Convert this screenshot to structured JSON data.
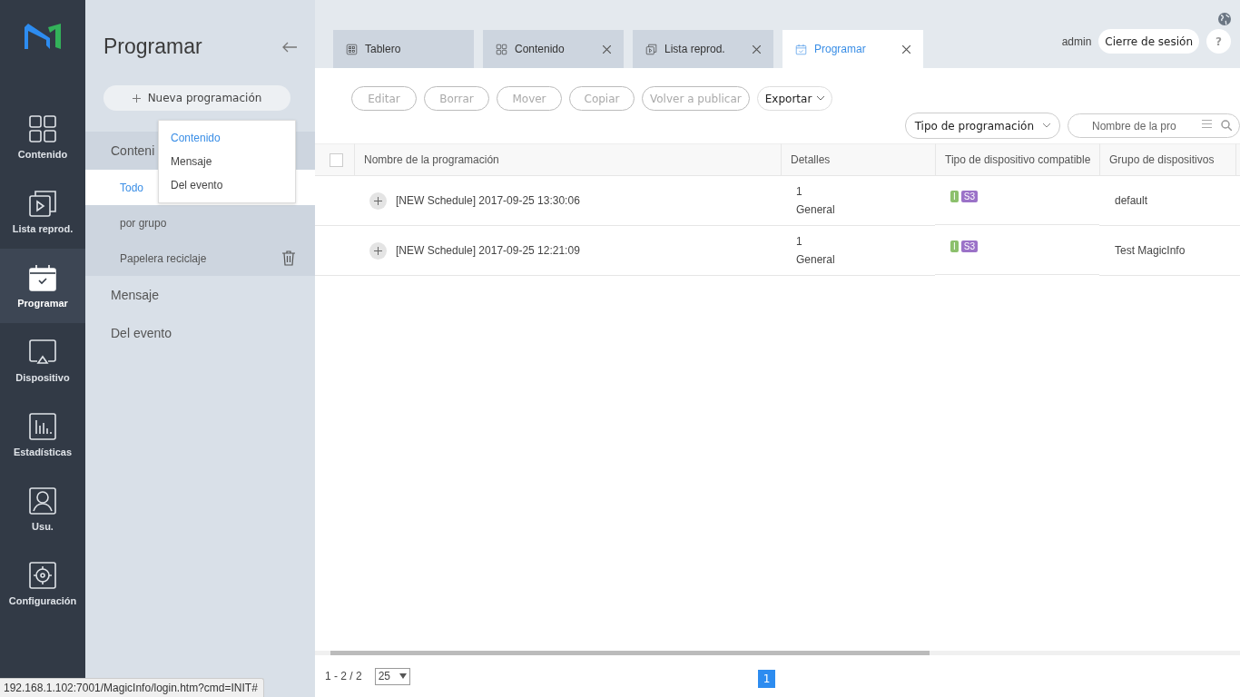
{
  "nav": {
    "items": [
      {
        "label": "Contenido",
        "selected": false
      },
      {
        "label": "Lista reprod.",
        "selected": false
      },
      {
        "label": "Programar",
        "selected": true
      },
      {
        "label": "Dispositivo",
        "selected": false
      },
      {
        "label": "Estadísticas",
        "selected": false
      },
      {
        "label": "Usu.",
        "selected": false
      },
      {
        "label": "Configuración",
        "selected": false
      }
    ]
  },
  "panel": {
    "title": "Programar",
    "new_button": "Nueva programación",
    "menu": [
      {
        "label": "Contenido",
        "selected": true
      },
      {
        "label": "Mensaje",
        "selected": false
      },
      {
        "label": "Del evento",
        "selected": false
      }
    ],
    "tree": [
      {
        "label": "Conteni",
        "expanded": true,
        "children": [
          {
            "label": "Todo",
            "selected": true,
            "kind": "plain"
          },
          {
            "label": "por grupo",
            "selected": false,
            "kind": "plain"
          },
          {
            "label": "Papelera reciclaje",
            "selected": false,
            "kind": "trash"
          }
        ]
      },
      {
        "label": "Mensaje",
        "expanded": false
      },
      {
        "label": "Del evento",
        "expanded": false
      }
    ]
  },
  "tabs": [
    {
      "label": "Tablero",
      "selected": false,
      "closable": false
    },
    {
      "label": "Contenido",
      "selected": false,
      "closable": true
    },
    {
      "label": "Lista reprod.",
      "selected": false,
      "closable": true
    },
    {
      "label": "Programar",
      "selected": true,
      "closable": true
    }
  ],
  "header": {
    "user": "admin",
    "logout": "Cierre de sesión",
    "help": "?"
  },
  "toolbar": [
    {
      "label": "Editar",
      "disabled": true
    },
    {
      "label": "Borrar",
      "disabled": true
    },
    {
      "label": "Mover",
      "disabled": true
    },
    {
      "label": "Copiar",
      "disabled": true
    },
    {
      "label": "Volver a publicar",
      "disabled": true
    }
  ],
  "export": "Exportar",
  "filter": "Tipo de programación",
  "search": {
    "placeholder": "Nombre de la pro"
  },
  "table": {
    "select_all": {
      "checked": false
    },
    "columns": [
      "Nombre de la programación",
      "Detalles",
      "Tipo de dispositivo compatible",
      "Grupo de dispositivos"
    ],
    "rows": [
      {
        "name": "[NEW Schedule] 2017-09-25 13:30:06",
        "details": [
          "1",
          "General"
        ],
        "types": [
          {
            "label": "I",
            "color": "#8cc06c"
          },
          {
            "label": "S3",
            "color": "#9b72c8"
          }
        ],
        "group": "default"
      },
      {
        "name": "[NEW Schedule] 2017-09-25 12:21:09",
        "details": [
          "1",
          "General"
        ],
        "types": [
          {
            "label": "I",
            "color": "#8cc06c"
          },
          {
            "label": "S3",
            "color": "#9b72c8"
          }
        ],
        "group": "Test MagicInfo"
      }
    ]
  },
  "pagination": {
    "range": "1 - 2 / 2",
    "page_size": "25",
    "pages": [
      {
        "label": "1",
        "selected": true
      }
    ]
  },
  "status_bar": "192.168.1.102:7001/MagicInfo/login.htm?cmd=INIT#"
}
